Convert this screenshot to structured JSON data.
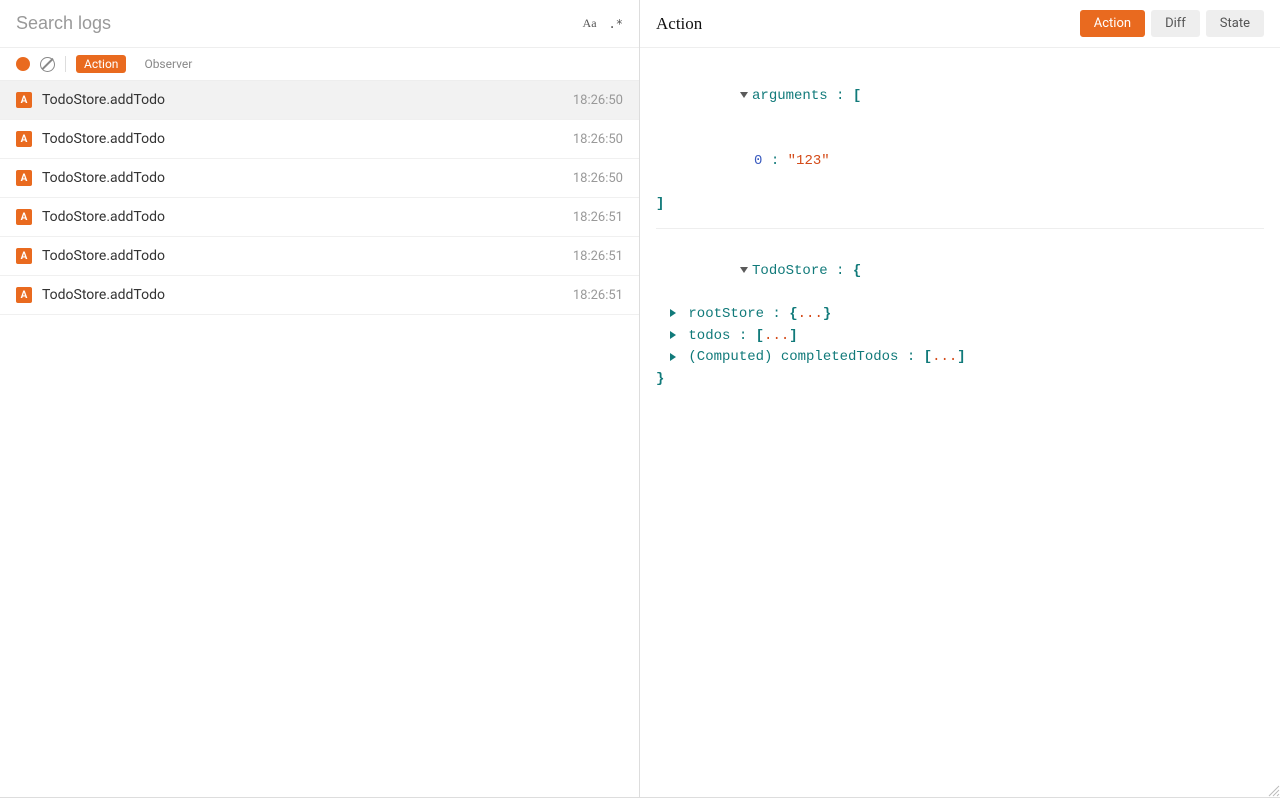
{
  "left": {
    "searchPlaceholder": "Search logs",
    "controls": {
      "case": "Aa",
      "regex": ".*"
    },
    "filters": {
      "action": "Action",
      "observer": "Observer"
    },
    "logs": [
      {
        "badge": "A",
        "title": "TodoStore.addTodo",
        "time": "18:26:50",
        "selected": true
      },
      {
        "badge": "A",
        "title": "TodoStore.addTodo",
        "time": "18:26:50",
        "selected": false
      },
      {
        "badge": "A",
        "title": "TodoStore.addTodo",
        "time": "18:26:50",
        "selected": false
      },
      {
        "badge": "A",
        "title": "TodoStore.addTodo",
        "time": "18:26:51",
        "selected": false
      },
      {
        "badge": "A",
        "title": "TodoStore.addTodo",
        "time": "18:26:51",
        "selected": false
      },
      {
        "badge": "A",
        "title": "TodoStore.addTodo",
        "time": "18:26:51",
        "selected": false
      }
    ]
  },
  "right": {
    "title": "Action",
    "tabs": {
      "action": "Action",
      "diff": "Diff",
      "state": "State"
    },
    "arguments": {
      "label": "arguments",
      "openBracket": "[",
      "closeBracket": "]",
      "items": [
        {
          "index": "0",
          "value": "\"123\""
        }
      ]
    },
    "store": {
      "label": "TodoStore",
      "openBrace": "{",
      "closeBrace": "}",
      "props": [
        {
          "key": "rootStore",
          "open": "{",
          "ellipsis": "...",
          "close": "}"
        },
        {
          "key": "todos",
          "open": "[",
          "ellipsis": "...",
          "close": "]"
        },
        {
          "key": "(Computed) completedTodos",
          "open": "[",
          "ellipsis": "...",
          "close": "]"
        }
      ]
    }
  }
}
